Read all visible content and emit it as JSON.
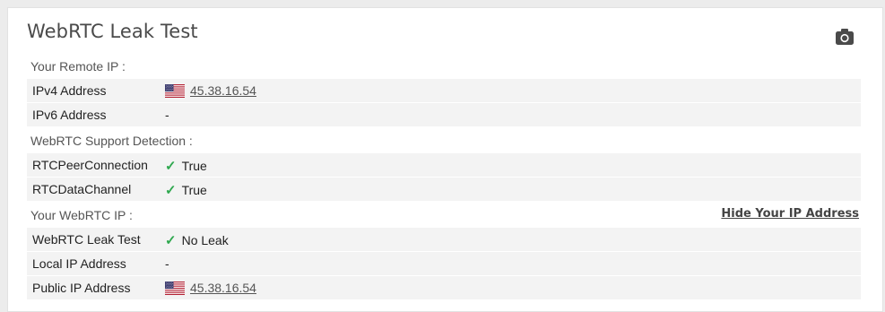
{
  "title": "WebRTC Leak Test",
  "icons": {
    "camera": "camera-icon",
    "flag": "us-flag-icon",
    "check": "check-icon"
  },
  "colors": {
    "check": "#2fa84f",
    "row_bg": "#f3f3f3"
  },
  "sections": {
    "remote_ip": {
      "label": "Your Remote IP :",
      "rows": [
        {
          "key": "IPv4 Address",
          "value": "45.38.16.54"
        },
        {
          "key": "IPv6 Address",
          "value": "-"
        }
      ]
    },
    "support": {
      "label": "WebRTC Support Detection :",
      "rows": [
        {
          "key": "RTCPeerConnection",
          "value": "True"
        },
        {
          "key": "RTCDataChannel",
          "value": "True"
        }
      ]
    },
    "webrtc_ip": {
      "label": "Your WebRTC IP :",
      "hide_link": "Hide Your IP Address",
      "rows": [
        {
          "key": "WebRTC Leak Test",
          "value": "No Leak"
        },
        {
          "key": "Local IP Address",
          "value": "-"
        },
        {
          "key": "Public IP Address",
          "value": "45.38.16.54"
        }
      ]
    }
  }
}
